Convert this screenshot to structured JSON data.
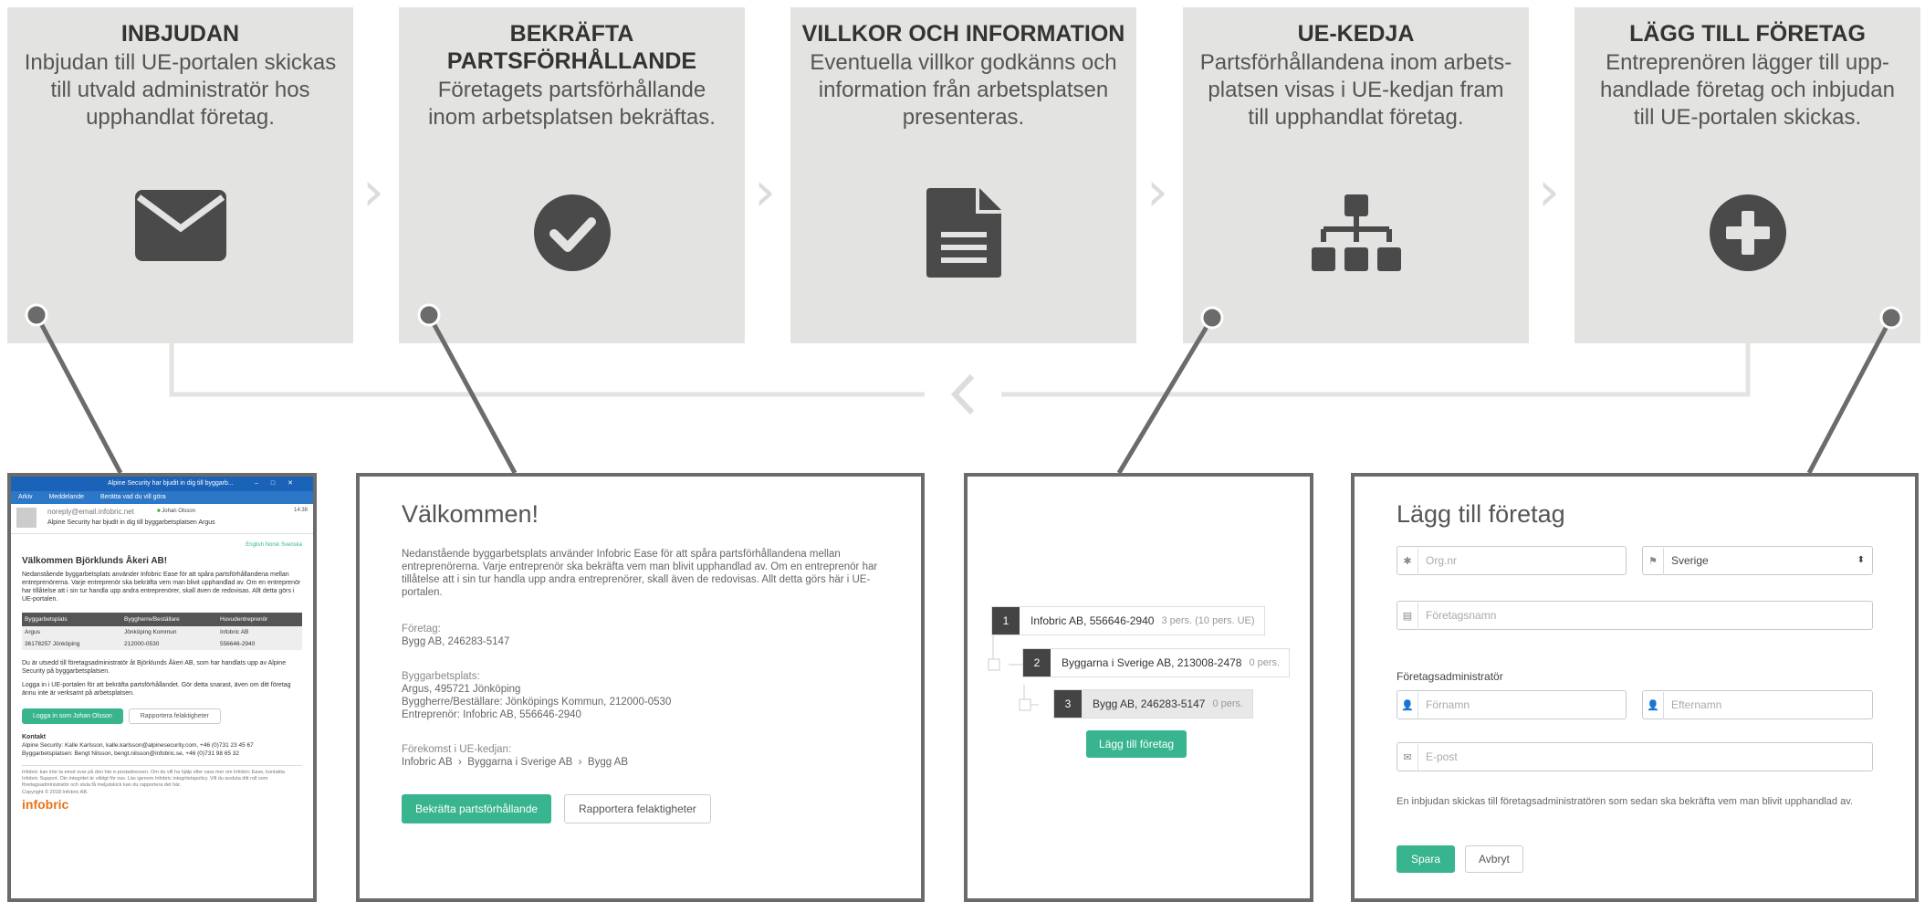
{
  "steps": [
    {
      "title": "INBJUDAN",
      "desc": "Inbjudan till UE-portalen skickas till utvald administratör hos upphandlat företag.",
      "icon": "envelope-icon"
    },
    {
      "title": "BEKRÄFTA PARTSFÖRHÅLLANDE",
      "desc": "Företagets partsförhållande inom arbetsplatsen bekräftas.",
      "icon": "checkmark-circle-icon"
    },
    {
      "title": "VILLKOR OCH INFORMATION",
      "desc": "Eventuella villkor godkänns och information från arbetsplatsen presenteras.",
      "icon": "document-icon"
    },
    {
      "title": "UE-KEDJA",
      "desc": "Partsförhållandena inom arbets-platsen visas i UE-kedjan fram till upphandlat företag.",
      "icon": "org-chart-icon"
    },
    {
      "title": "LÄGG TILL FÖRETAG",
      "desc": "Entreprenören lägger till upp-handlade företag och inbjudan till UE-portalen skickas.",
      "icon": "plus-circle-icon"
    }
  ],
  "email": {
    "window_title": "Alpine Security har bjudit in dig till byggarb...",
    "menu": [
      "Arkiv",
      "Meddelande",
      "Berätta vad du vill göra"
    ],
    "sender": "noreply@email.infobric.net",
    "recipient": "Johan Olsson",
    "time": "14:38",
    "subject": "Alpine Security har bjudit in dig till byggarbetsplatsen Argus",
    "langs": "English  Norsk  Svenska",
    "heading": "Välkommen Björklunds Åkeri AB!",
    "intro": "Nedanstående byggarbetsplats använder Infobric Ease för att spåra partsförhållandena mellan entreprenörerna. Varje entreprenör ska bekräfta vem man blivit upphandlad av. Om en entreprenör har tillåtelse att i sin tur handla upp andra entreprenörer, skall även de redovisas. Allt detta görs i UE-portalen.",
    "table_headers": [
      "Byggarbetsplats",
      "Byggherre/Beställare",
      "Huvudentreprenör"
    ],
    "table_row1": [
      "Argus",
      "Jönköping Kommun",
      "Infobric AB"
    ],
    "table_row2": [
      "36178257 Jönköping",
      "212000-0530",
      "556646-2940"
    ],
    "para2": "Du är utsedd till företagsadministratör åt Björklunds Åkeri AB, som har handlats upp av Alpine Security på byggarbetsplatsen.",
    "para3": "Logga in i UE-portalen för att bekräfta partsförhållandet. Gör detta snarast, även om ditt företag ännu inte är verksamt på arbetsplatsen.",
    "login_button": "Logga in som Johan Olsson",
    "report_button": "Rapportera felaktigheter",
    "contact_title": "Kontakt",
    "contact1": "Alpine Security: Kalle Karlsson, kalle.karlsson@alpinesecurity.com, +46 (0)731 23 45 67",
    "contact2": "Byggarbetsplatsen: Bengt Nilsson, bengt.nilsson@infobric.se, +46 (0)731 98 65 32",
    "footer": "Infobric kan inte ta emot svar på den här e-postadressen. Om du vill ha hjälp eller vara mer om Infobric Ease, kontakta Infobric Support. Din integritet är viktigt för oss. Läs igenom Infobric integritetspolicy. Vill du avsluta ditt roll som företagsadministratör och slula få meljutskick kan du rapportera det här.",
    "copyright": "Copyright © 2018 Infobric AB.",
    "logo": "infobric"
  },
  "confirm": {
    "title": "Välkommen!",
    "intro": "Nedanstående byggarbetsplats använder Infobric Ease för att spåra partsförhållandena mellan entreprenörerna. Varje entreprenör ska bekräfta vem man blivit upphandlad av. Om en entreprenör har tillåtelse att i sin tur handla upp andra entreprenörer, skall även de redovisas. Allt detta görs här i UE-portalen.",
    "company_label": "Företag:",
    "company_value": "Bygg AB, 246283-5147",
    "site_label": "Byggarbetsplats:",
    "site_line1": "Argus, 495721 Jönköping",
    "site_line2": "Byggherre/Beställare: Jönköpings Kommun, 212000-0530",
    "site_line3": "Entreprenör: Infobric AB, 556646-2940",
    "chain_label": "Förekomst i UE-kedjan:",
    "chain_value": "Infobric AB  ›  Byggarna i Sverige AB  ›  Bygg AB",
    "confirm_button": "Bekräfta partsförhållande",
    "report_button": "Rapportera felaktigheter"
  },
  "chain": {
    "items": [
      {
        "num": "1",
        "name": "Infobric AB, 556646-2940",
        "count": "3 pers. (10 pers. UE)"
      },
      {
        "num": "2",
        "name": "Byggarna i Sverige AB, 213008-2478",
        "count": "0 pers."
      },
      {
        "num": "3",
        "name": "Bygg AB, 246283-5147",
        "count": "0 pers."
      }
    ],
    "add_button": "Lägg till företag"
  },
  "addform": {
    "title": "Lägg till företag",
    "orgnr_placeholder": "Org.nr",
    "country_value": "Sverige",
    "company_placeholder": "Företagsnamn",
    "admin_label": "Företagsadministratör",
    "firstname_placeholder": "Förnamn",
    "lastname_placeholder": "Efternamn",
    "email_placeholder": "E-post",
    "note": "En inbjudan skickas till företagsadministratören som sedan ska bekräfta vem man blivit upphandlad av.",
    "save_button": "Spara",
    "cancel_button": "Avbryt"
  },
  "colors": {
    "panel": "#e3e3e1",
    "icon": "#4a4a4a",
    "line": "#6b6b6b",
    "accent": "#38b48f",
    "outlook": "#1a63b8"
  }
}
